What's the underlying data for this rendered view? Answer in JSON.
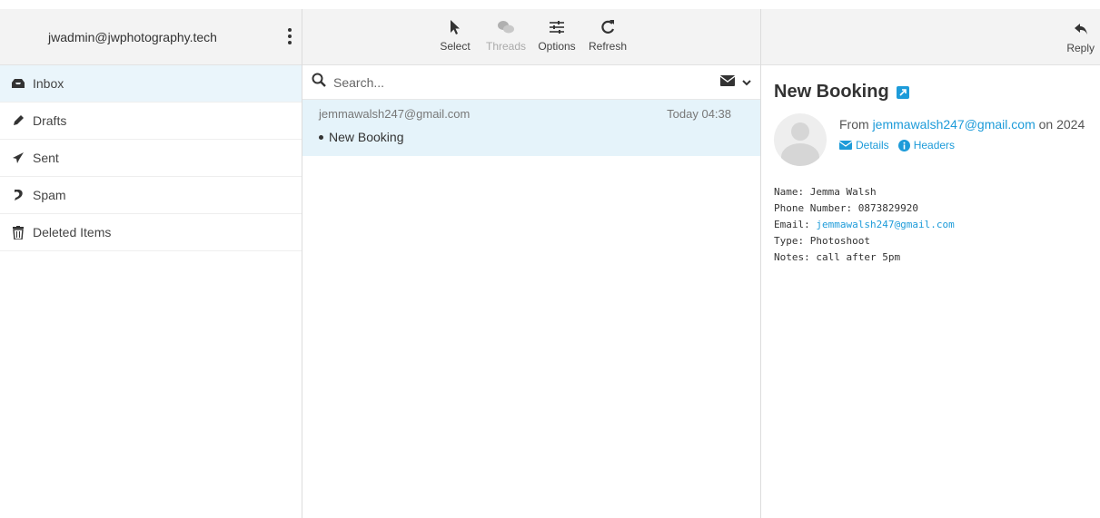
{
  "account": {
    "email": "jwadmin@jwphotography.tech"
  },
  "folders": [
    {
      "label": "Inbox",
      "icon": "inbox-icon",
      "active": true
    },
    {
      "label": "Drafts",
      "icon": "pencil-icon"
    },
    {
      "label": "Sent",
      "icon": "paper-plane-icon"
    },
    {
      "label": "Spam",
      "icon": "spam-icon"
    },
    {
      "label": "Deleted Items",
      "icon": "trash-icon"
    }
  ],
  "toolbar": {
    "select": "Select",
    "threads": "Threads",
    "options": "Options",
    "refresh": "Refresh",
    "reply": "Reply"
  },
  "search": {
    "placeholder": "Search..."
  },
  "messages": [
    {
      "from": "jemmawalsh247@gmail.com",
      "date": "Today 04:38",
      "subject": "New Booking"
    }
  ],
  "reading": {
    "subject": "New Booking",
    "from_prefix": "From",
    "from_email": "jemmawalsh247@gmail.com",
    "from_suffix": "on 2024",
    "details": "Details",
    "headers": "Headers",
    "body": {
      "name": "Name: Jemma Walsh",
      "phone": "Phone Number: 0873829920",
      "email_label": "Email:",
      "email_value": "jemmawalsh247@gmail.com",
      "type": "Type: Photoshoot",
      "notes": "Notes: call after 5pm"
    }
  },
  "colors": {
    "accent": "#1d9bd9",
    "selected_bg": "#e5f3fa",
    "header_bg": "#f3f3f3"
  }
}
